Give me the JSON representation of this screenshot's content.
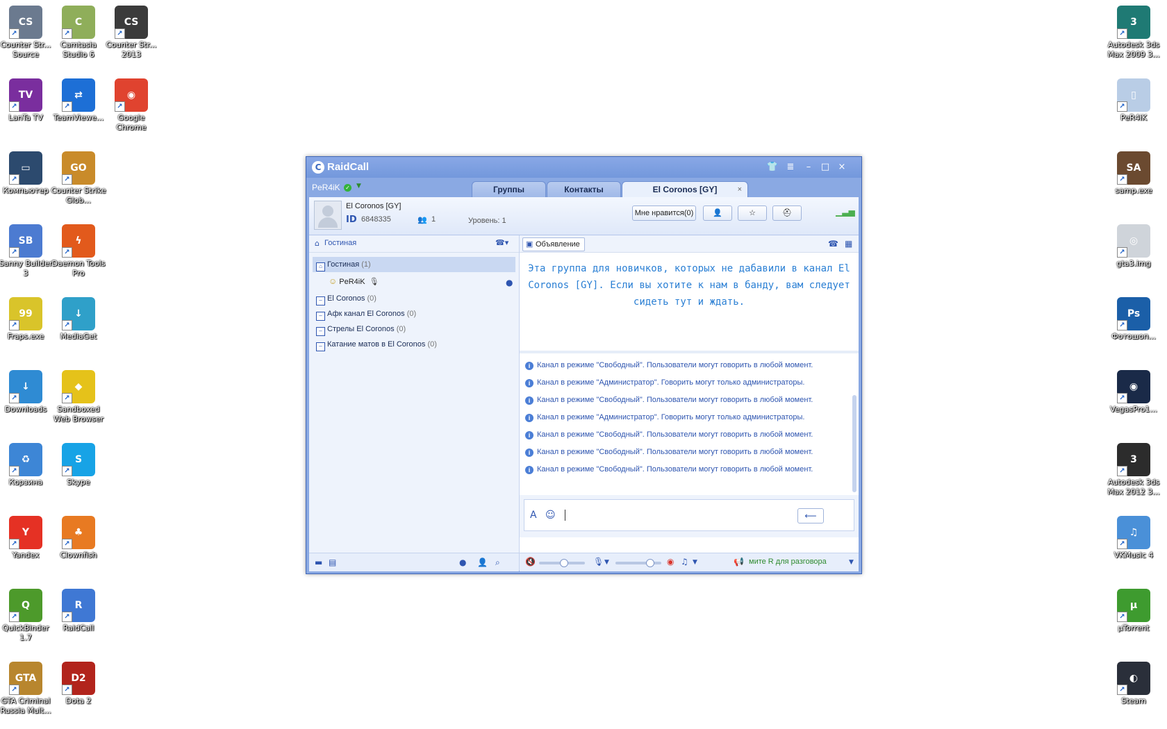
{
  "desktop": {
    "left_icons": [
      {
        "label": "Counter Str... Source",
        "icon": "counter-strike-source-icon",
        "color": "#6b7a8f",
        "glyph": "CS"
      },
      {
        "label": "Camtasia Studio 6",
        "icon": "camtasia-icon",
        "color": "#8fae5a",
        "glyph": "C"
      },
      {
        "label": "Counter Str... 2013",
        "icon": "counter-strike-2013-icon",
        "color": "#3b3b3b",
        "glyph": "CS"
      },
      {
        "label": "LanTa TV",
        "icon": "lanta-tv-icon",
        "color": "#7a2e9e",
        "glyph": "TV"
      },
      {
        "label": "TeamViewe...",
        "icon": "teamviewer-icon",
        "color": "#1d6fd6",
        "glyph": "⇄"
      },
      {
        "label": "Google Chrome",
        "icon": "chrome-icon",
        "color": "#e0432f",
        "glyph": "◉"
      },
      {
        "label": "Компьютер",
        "icon": "computer-icon",
        "color": "#2c4a6e",
        "glyph": "▭"
      },
      {
        "label": "Counter Strike Glob...",
        "icon": "cs-go-icon",
        "color": "#c98b2a",
        "glyph": "GO"
      },
      {
        "label": "Sanny Builder 3",
        "icon": "sanny-builder-icon",
        "color": "#4c7bd1",
        "glyph": "SB"
      },
      {
        "label": "Daemon Tools Pro",
        "icon": "daemon-tools-icon",
        "color": "#e25a1c",
        "glyph": "ϟ"
      },
      {
        "label": "Fraps.exe",
        "icon": "fraps-icon",
        "color": "#d9c42a",
        "glyph": "99"
      },
      {
        "label": "MediaGet",
        "icon": "mediaget-icon",
        "color": "#2fa0c9",
        "glyph": "↓"
      },
      {
        "label": "Downloads",
        "icon": "downloads-folder-icon",
        "color": "#2f8bd3",
        "glyph": "↓"
      },
      {
        "label": "Sandboxed Web Browser",
        "icon": "sandboxed-browser-icon",
        "color": "#e5c21a",
        "glyph": "◆"
      },
      {
        "label": "Корзина",
        "icon": "recycle-bin-icon",
        "color": "#3d86d6",
        "glyph": "♻"
      },
      {
        "label": "Skype",
        "icon": "skype-icon",
        "color": "#17a3e6",
        "glyph": "S"
      },
      {
        "label": "Yandex",
        "icon": "yandex-icon",
        "color": "#e53124",
        "glyph": "Y"
      },
      {
        "label": "Clownfish",
        "icon": "clownfish-icon",
        "color": "#e87a22",
        "glyph": "♣"
      },
      {
        "label": "QuickBinder 1.7",
        "icon": "quickbinder-icon",
        "color": "#4d9a2b",
        "glyph": "Q"
      },
      {
        "label": "RaidCall",
        "icon": "raidcall-icon",
        "color": "#3f78d4",
        "glyph": "R"
      },
      {
        "label": "GTA Criminal Russia Mult...",
        "icon": "gta-criminal-russia-icon",
        "color": "#b8862e",
        "glyph": "GTA"
      },
      {
        "label": "Dota 2",
        "icon": "dota2-icon",
        "color": "#b2241c",
        "glyph": "D2"
      }
    ],
    "right_icons": [
      {
        "label": "Autodesk 3ds Max 2009 3...",
        "icon": "3ds-max-2009-icon",
        "color": "#1f7a74",
        "glyph": "3"
      },
      {
        "label": "PeR4iK",
        "icon": "folder-icon",
        "color": "#b9cde6",
        "glyph": "▯"
      },
      {
        "label": "samp.exe",
        "icon": "samp-icon",
        "color": "#6b4a30",
        "glyph": "SA"
      },
      {
        "label": "gta3.img",
        "icon": "disc-image-icon",
        "color": "#cfd4da",
        "glyph": "◎"
      },
      {
        "label": "Фотошоп...",
        "icon": "photoshop-icon",
        "color": "#1b5fa8",
        "glyph": "Ps"
      },
      {
        "label": "VegasPro1...",
        "icon": "vegas-pro-icon",
        "color": "#1a2a48",
        "glyph": "◉"
      },
      {
        "label": "Autodesk 3ds Max 2012 3...",
        "icon": "3ds-max-2012-icon",
        "color": "#2c2c2c",
        "glyph": "3"
      },
      {
        "label": "VKMusic 4",
        "icon": "vkmusic-icon",
        "color": "#4a90d8",
        "glyph": "♫"
      },
      {
        "label": "µTorrent",
        "icon": "utorrent-icon",
        "color": "#3e9b2f",
        "glyph": "µ"
      },
      {
        "label": "Steam",
        "icon": "steam-icon",
        "color": "#2a2f3a",
        "glyph": "◐"
      }
    ]
  },
  "window": {
    "app_name": "RaidCall",
    "user_name": "PeR4iK",
    "tabs": [
      "Группы",
      "Контакты",
      "El Coronos [GY]"
    ],
    "tab_close": "×",
    "group": {
      "name": "El Coronos [GY]",
      "id_label": "ID",
      "id": "6848335",
      "members": "1",
      "level": "Уровень: 1",
      "like_button": "Мне нравится(0)"
    },
    "left": {
      "header": "Гостиная",
      "channels": [
        {
          "name": "Гостиная",
          "count": "(1)"
        },
        {
          "name": "El Coronos",
          "count": "(0)"
        },
        {
          "name": "Афк канал El Coronos",
          "count": "(0)"
        },
        {
          "name": "Стрелы El Coronos",
          "count": "(0)"
        },
        {
          "name": "Катание матов в El Coronos",
          "count": "(0)"
        }
      ],
      "user": "PeR4iK"
    },
    "right": {
      "announcement_button": "Объявление",
      "announcement_text": "Эта группа для новичков, которых не дабавили в канал El Coronos [GY]. Если вы хотите к нам в банду, вам следует сидеть тут и ждать.",
      "log": [
        "Канал в режиме \"Свободный\". Пользователи могут говорить в любой момент.",
        "Канал в режиме \"Администратор\". Говорить могут только администраторы.",
        "Канал в режиме \"Свободный\". Пользователи могут говорить в любой момент.",
        "Канал в режиме \"Администратор\". Говорить могут только администраторы.",
        "Канал в режиме \"Свободный\". Пользователи могут говорить в любой момент.",
        "Канал в режиме \"Свободный\". Пользователи могут говорить в любой момент.",
        "Канал в режиме \"Свободный\". Пользователи могут говорить в любой момент."
      ],
      "push_to_talk": "мите R для разговора"
    }
  }
}
